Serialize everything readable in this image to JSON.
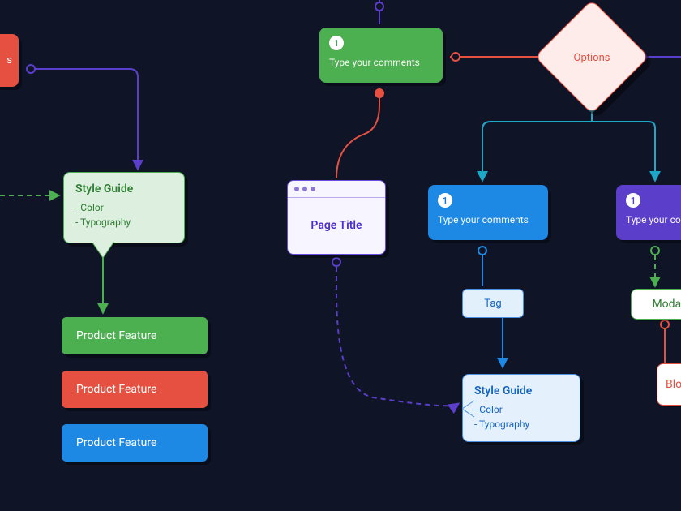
{
  "comment_green": {
    "badge": "1",
    "text": "Type your comments"
  },
  "comment_blue": {
    "badge": "1",
    "text": "Type your comments"
  },
  "comment_purple": {
    "badge": "1",
    "text": "Type your comments"
  },
  "options_node": {
    "label": "Options"
  },
  "style_guide_green": {
    "title": "Style Guide",
    "item1": "- Color",
    "item2": "- Typography"
  },
  "style_guide_blue": {
    "title": "Style Guide",
    "item1": "- Color",
    "item2": "- Typography"
  },
  "page_window": {
    "title": "Page Title"
  },
  "tag_node": {
    "label": "Tag"
  },
  "modal_node": {
    "label": "Modal"
  },
  "block_node": {
    "label": "Block"
  },
  "feature_green": {
    "label": "Product Feature"
  },
  "feature_red": {
    "label": "Product Feature"
  },
  "feature_blue": {
    "label": "Product Feature"
  },
  "red_partial": {
    "text": "s"
  },
  "colors": {
    "green": "#4caf50",
    "green_dark": "#3da35d",
    "red": "#e65040",
    "blue": "#1e88e5",
    "royal_blue": "#1565c0",
    "purple": "#5b3ec9",
    "teal": "#1ea7c6"
  }
}
